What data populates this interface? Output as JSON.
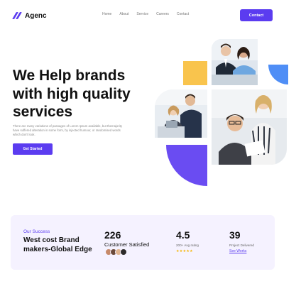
{
  "header": {
    "brand": "Agenc",
    "nav": [
      "Home",
      "About",
      "Service",
      "Careers",
      "Contact"
    ],
    "contact_button": "Contact"
  },
  "hero": {
    "title": "We Help brands with high quality services",
    "description": "There are many variations of passages of Lorem Ipsum available, but themajority have suffered alteration in some form, by injected humour, or randomised words which don't look.",
    "cta": "Get Started"
  },
  "stats": {
    "eyebrow": "Our Success",
    "heading": "West cost Brand makers-Global Edge",
    "items": [
      {
        "value": "226",
        "label": "Customer Satisfied"
      },
      {
        "value": "4.5",
        "label": "200+ Avg rating",
        "stars": "★★★★★"
      },
      {
        "value": "39",
        "label": "Project Delivered",
        "link": "See Works"
      }
    ]
  },
  "colors": {
    "accent": "#5b3cf0",
    "yellow": "#f9c44d",
    "blue": "#4f8ef6",
    "panel": "#f5f2ff"
  }
}
